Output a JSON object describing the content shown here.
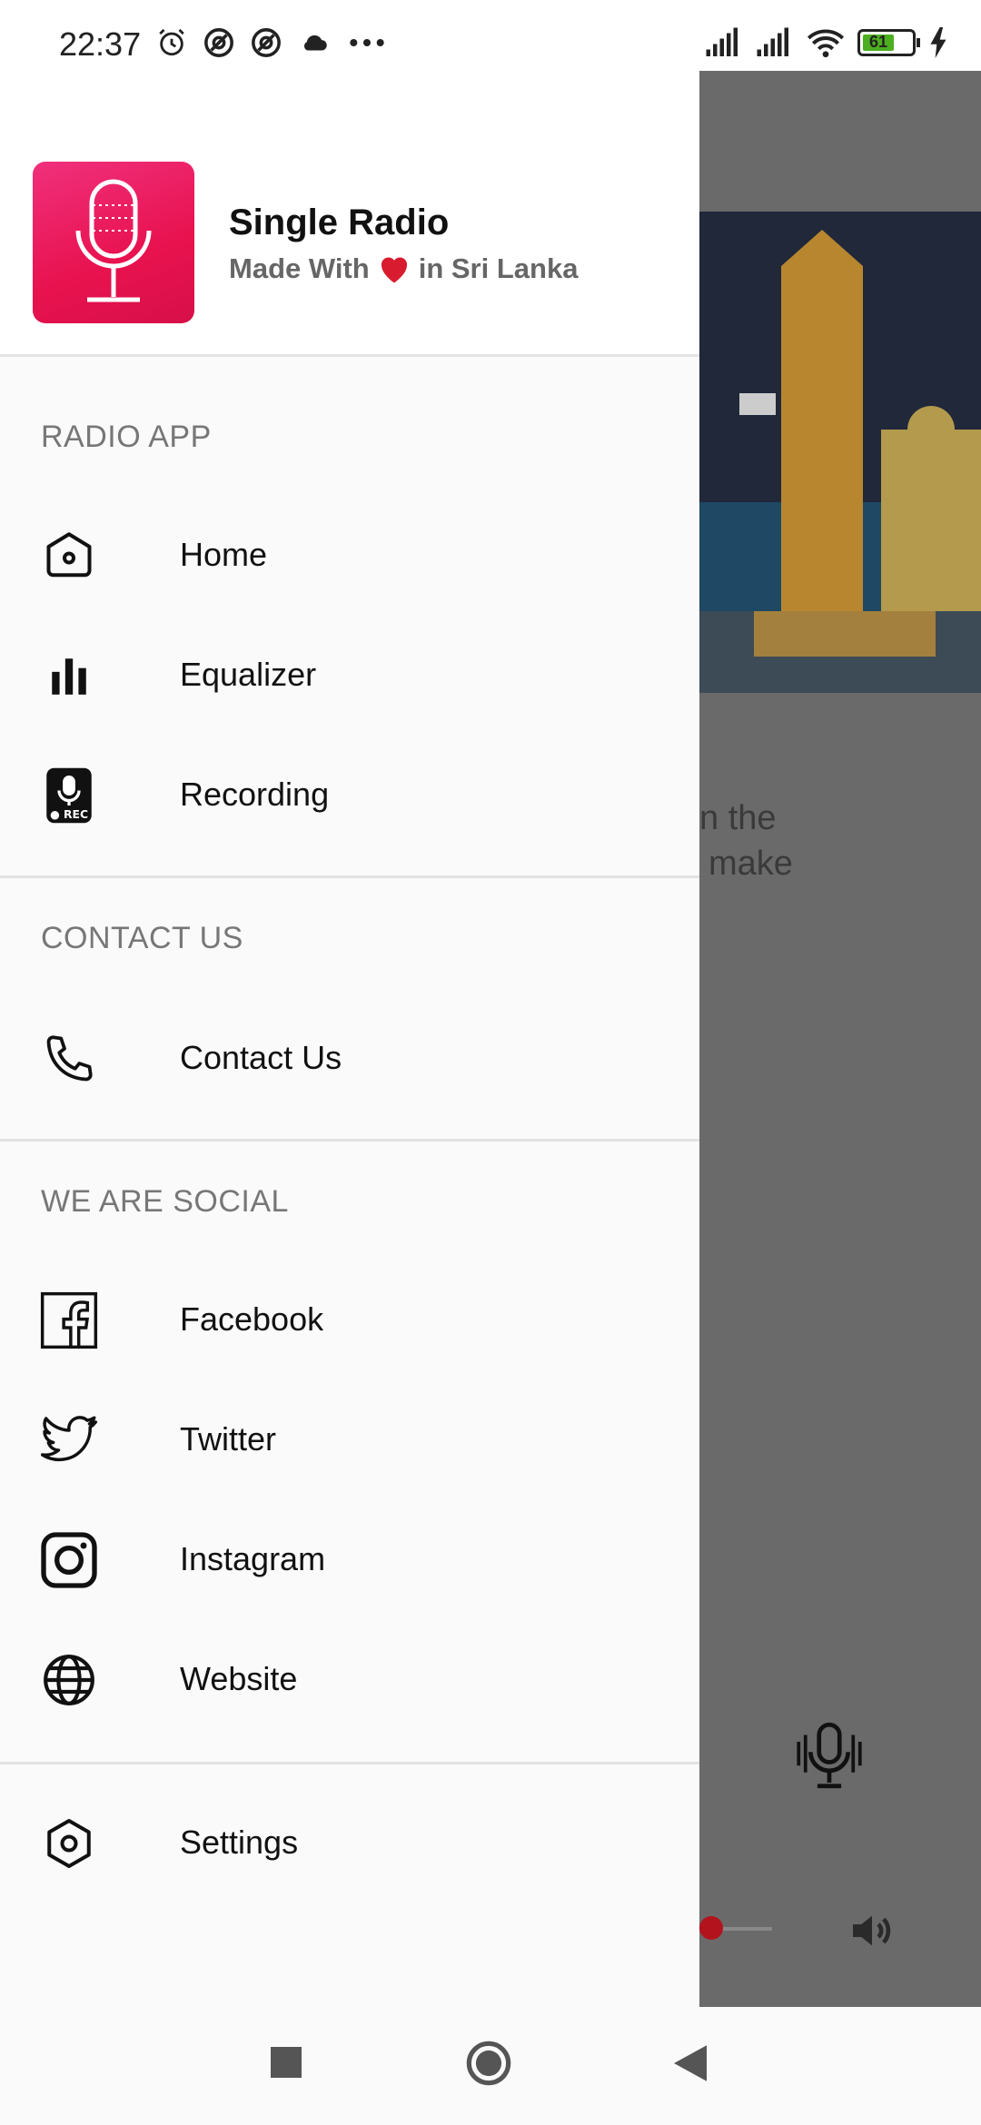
{
  "status_bar": {
    "time": "22:37",
    "battery": "61",
    "icons": [
      "alarm-icon",
      "at-icon",
      "at-icon",
      "cloud-icon",
      "more-icon",
      "signal-icon",
      "signal-icon",
      "wifi-icon",
      "battery-icon",
      "charging-icon"
    ]
  },
  "drawer": {
    "app_name": "Single Radio",
    "tagline_prefix": "Made With",
    "tagline_suffix": "in Sri Lanka",
    "sections": {
      "radio_app": {
        "title": "RADIO APP",
        "items": [
          {
            "label": "Home",
            "icon": "home-icon"
          },
          {
            "label": "Equalizer",
            "icon": "equalizer-icon"
          },
          {
            "label": "Recording",
            "icon": "recording-icon"
          }
        ]
      },
      "contact": {
        "title": "CONTACT US",
        "items": [
          {
            "label": "Contact Us",
            "icon": "phone-icon"
          }
        ]
      },
      "social": {
        "title": "WE ARE SOCIAL",
        "items": [
          {
            "label": "Facebook",
            "icon": "facebook-icon"
          },
          {
            "label": "Twitter",
            "icon": "twitter-icon"
          },
          {
            "label": "Instagram",
            "icon": "instagram-icon"
          },
          {
            "label": "Website",
            "icon": "globe-icon"
          }
        ]
      },
      "settings": {
        "items": [
          {
            "label": "Settings",
            "icon": "settings-icon"
          }
        ]
      }
    }
  },
  "background": {
    "text_line1": "n the",
    "text_line2": "make"
  },
  "colors": {
    "accent": "#e8124f",
    "heart": "#d81b2e"
  }
}
